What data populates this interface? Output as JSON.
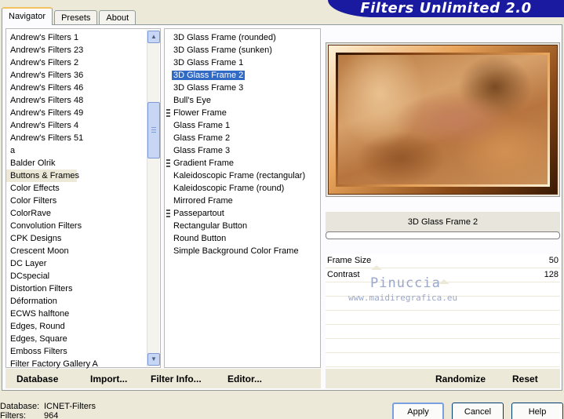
{
  "brand": {
    "title": "Filters Unlimited 2.0"
  },
  "tabs": [
    {
      "label": "Navigator",
      "active": true
    },
    {
      "label": "Presets",
      "active": false
    },
    {
      "label": "About",
      "active": false
    }
  ],
  "categories": [
    "Andrew's Filters 1",
    "Andrew's Filters 23",
    "Andrew's Filters 2",
    "Andrew's Filters 36",
    "Andrew's Filters 46",
    "Andrew's Filters 48",
    "Andrew's Filters 49",
    "Andrew's Filters 4",
    "Andrew's Filters 51",
    "a",
    "Balder Olrik",
    "Buttons & Frames",
    "Color Effects",
    "Color Filters",
    "ColorRave",
    "Convolution Filters",
    "CPK Designs",
    "Crescent Moon",
    "DC Layer",
    "DCspecial",
    "Distortion Filters",
    "Déformation",
    "ECWS halftone",
    "Edges, Round",
    "Edges, Square",
    "Emboss Filters",
    "Filter Factory Gallery A"
  ],
  "selected_category": "Buttons & Frames",
  "filters": [
    {
      "label": "3D Glass Frame (rounded)",
      "marker": false
    },
    {
      "label": "3D Glass Frame (sunken)",
      "marker": false
    },
    {
      "label": "3D Glass Frame 1",
      "marker": false
    },
    {
      "label": "3D Glass Frame 2",
      "marker": false,
      "selected": true
    },
    {
      "label": "3D Glass Frame 3",
      "marker": false
    },
    {
      "label": "Bull's Eye",
      "marker": false
    },
    {
      "label": "Flower Frame",
      "marker": true
    },
    {
      "label": "Glass Frame 1",
      "marker": false
    },
    {
      "label": "Glass Frame 2",
      "marker": false
    },
    {
      "label": "Glass Frame 3",
      "marker": false
    },
    {
      "label": "Gradient Frame",
      "marker": true
    },
    {
      "label": "Kaleidoscopic Frame (rectangular)",
      "marker": false
    },
    {
      "label": "Kaleidoscopic Frame (round)",
      "marker": false
    },
    {
      "label": "Mirrored Frame",
      "marker": false
    },
    {
      "label": "Passepartout",
      "marker": true
    },
    {
      "label": "Rectangular Button",
      "marker": false
    },
    {
      "label": "Round Button",
      "marker": false
    },
    {
      "label": "Simple Background Color Frame",
      "marker": false
    }
  ],
  "current_filter": "3D Glass Frame 2",
  "params": [
    {
      "label": "Frame Size",
      "value": "50",
      "level": 0.196
    },
    {
      "label": "Contrast",
      "value": "128",
      "level": 0.502
    }
  ],
  "watermark": {
    "name": "Pinuccia",
    "url": "www.maidiregrafica.eu"
  },
  "left_buttons": {
    "database": "Database",
    "import": "Import...",
    "filter_info": "Filter Info...",
    "editor": "Editor..."
  },
  "right_buttons": {
    "randomize": "Randomize",
    "reset": "Reset"
  },
  "status": {
    "database_label": "Database:",
    "database_value": "ICNET-Filters",
    "filters_label": "Filters:",
    "filters_value": "964"
  },
  "dialog": {
    "apply": "Apply",
    "cancel": "Cancel",
    "help": "Help"
  },
  "colors": {
    "selection": "#316ac5",
    "banner": "#1a1aa0",
    "panel": "#ece9d8"
  }
}
